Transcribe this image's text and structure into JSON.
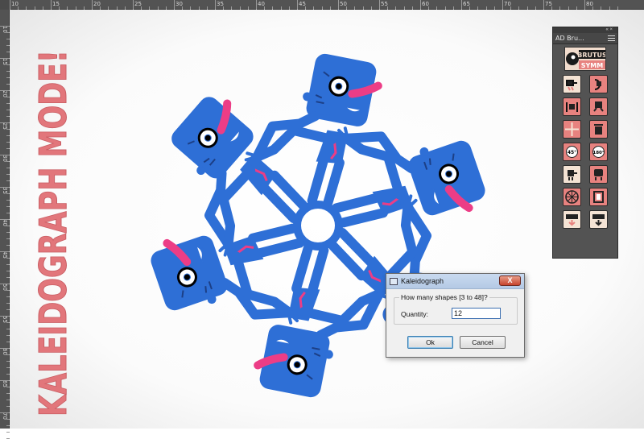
{
  "ruler": {
    "top_labels": [
      "10",
      "15",
      "20",
      "25",
      "30",
      "35",
      "40",
      "45",
      "50",
      "55",
      "60",
      "65",
      "70",
      "75",
      "80"
    ],
    "left_labels": [
      "10",
      "15",
      "20",
      "25",
      "30",
      "35",
      "40",
      "45",
      "50",
      "55",
      "60",
      "65",
      "70"
    ]
  },
  "headline": {
    "text": "KALEIDOGRAPH MODE!",
    "color": "#e2767b"
  },
  "artwork": {
    "figure_color": "#2e6fd6",
    "accent_color": "#ec3d86",
    "copies": 6
  },
  "panel": {
    "tab_label": "AD Bru...",
    "logo_line1": "BRUTUS",
    "logo_line2": "SYMM",
    "brushes": [
      "figure-brush-1",
      "figure-brush-2",
      "figure-brush-3",
      "figure-brush-4",
      "grid-brush",
      "trash-brush",
      "rotate-45-brush",
      "rotate-180-brush",
      "figure-brush-5",
      "figure-brush-6",
      "kaleidograph-brush",
      "frame-brush",
      "export-brush-1",
      "export-brush-2"
    ]
  },
  "dialog": {
    "title": "Kaleidograph",
    "close_label": "X",
    "group_label": "How many shapes [3 to 48]?",
    "quantity_label": "Quantity:",
    "quantity_value": "12",
    "ok_label": "Ok",
    "cancel_label": "Cancel"
  }
}
